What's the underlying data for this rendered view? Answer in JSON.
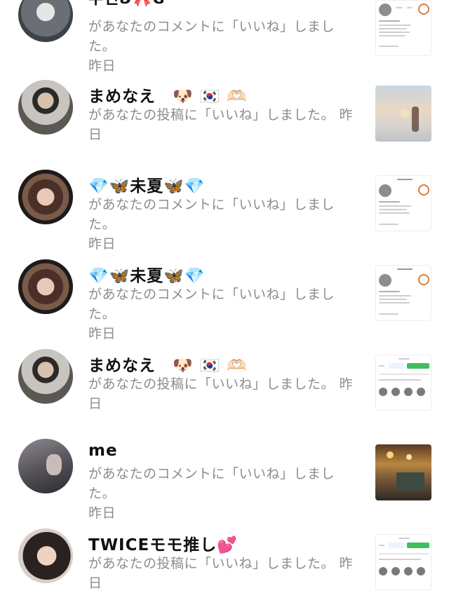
{
  "notifications": [
    {
      "name": "무민ʚ🎀ɞ",
      "message": "があなたのコメントに「いいね」しました。",
      "time": "昨日",
      "avatar_color": "#5a5f66",
      "thumb_type": "profile"
    },
    {
      "name": "まめなえ　🐶 🇰🇷 🫶🏻",
      "message": "があなたの投稿に「いいね」しました。",
      "time": "昨日",
      "avatar_color": "#8a847c",
      "thumb_type": "photo-sunset"
    },
    {
      "name": "💎🦋未夏🦋💎",
      "message": "があなたのコメントに「いいね」しました。",
      "time": "昨日",
      "avatar_color": "#6b4a3c",
      "thumb_type": "profile"
    },
    {
      "name": "💎🦋未夏🦋💎",
      "message": "があなたのコメントに「いいね」しました。",
      "time": "昨日",
      "avatar_color": "#6b4a3c",
      "thumb_type": "profile"
    },
    {
      "name": "まめなえ　🐶 🇰🇷 🫶🏻",
      "message": "があなたの投稿に「いいね」しました。",
      "time": "昨日",
      "avatar_color": "#8a847c",
      "thumb_type": "list-green"
    },
    {
      "name": "me",
      "message": "があなたのコメントに「いいね」しました。",
      "time": "昨日",
      "avatar_color": "#6d6a70",
      "thumb_type": "photo-room"
    },
    {
      "name": "TWICEモモ推し💕",
      "message": "があなたの投稿に「いいね」しました。",
      "time": "昨日",
      "avatar_color": "#3a2f2b",
      "thumb_type": "list-green"
    }
  ]
}
